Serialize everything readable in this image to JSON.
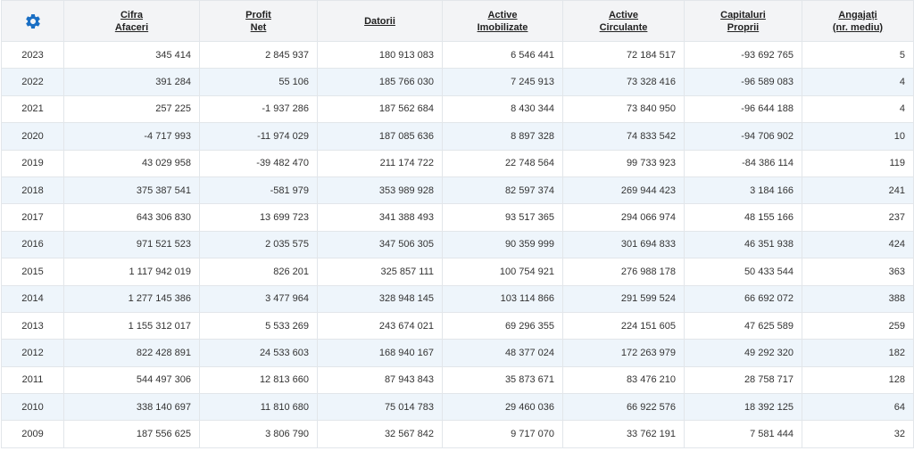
{
  "header": {
    "settings_icon": "gear-icon",
    "accent_color": "#1a6fc4",
    "columns": [
      {
        "line1": "Cifra",
        "line2": "Afaceri"
      },
      {
        "line1": "Profit",
        "line2": "Net"
      },
      {
        "line1": "Datorii",
        "line2": ""
      },
      {
        "line1": "Active",
        "line2": "Imobilizate"
      },
      {
        "line1": "Active",
        "line2": "Circulante"
      },
      {
        "line1": "Capitaluri",
        "line2": "Proprii"
      },
      {
        "line1": "Angajați",
        "line2": "(nr. mediu)"
      }
    ]
  },
  "rows": [
    [
      "2023",
      "345 414",
      "2 845 937",
      "180 913 083",
      "6 546 441",
      "72 184 517",
      "-93 692 765",
      "5"
    ],
    [
      "2022",
      "391 284",
      "55 106",
      "185 766 030",
      "7 245 913",
      "73 328 416",
      "-96 589 083",
      "4"
    ],
    [
      "2021",
      "257 225",
      "-1 937 286",
      "187 562 684",
      "8 430 344",
      "73 840 950",
      "-96 644 188",
      "4"
    ],
    [
      "2020",
      "-4 717 993",
      "-11 974 029",
      "187 085 636",
      "8 897 328",
      "74 833 542",
      "-94 706 902",
      "10"
    ],
    [
      "2019",
      "43 029 958",
      "-39 482 470",
      "211 174 722",
      "22 748 564",
      "99 733 923",
      "-84 386 114",
      "119"
    ],
    [
      "2018",
      "375 387 541",
      "-581 979",
      "353 989 928",
      "82 597 374",
      "269 944 423",
      "3 184 166",
      "241"
    ],
    [
      "2017",
      "643 306 830",
      "13 699 723",
      "341 388 493",
      "93 517 365",
      "294 066 974",
      "48 155 166",
      "237"
    ],
    [
      "2016",
      "971 521 523",
      "2 035 575",
      "347 506 305",
      "90 359 999",
      "301 694 833",
      "46 351 938",
      "424"
    ],
    [
      "2015",
      "1 117 942 019",
      "826 201",
      "325 857 111",
      "100 754 921",
      "276 988 178",
      "50 433 544",
      "363"
    ],
    [
      "2014",
      "1 277 145 386",
      "3 477 964",
      "328 948 145",
      "103 114 866",
      "291 599 524",
      "66 692 072",
      "388"
    ],
    [
      "2013",
      "1 155 312 017",
      "5 533 269",
      "243 674 021",
      "69 296 355",
      "224 151 605",
      "47 625 589",
      "259"
    ],
    [
      "2012",
      "822 428 891",
      "24 533 603",
      "168 940 167",
      "48 377 024",
      "172 263 979",
      "49 292 320",
      "182"
    ],
    [
      "2011",
      "544 497 306",
      "12 813 660",
      "87 943 843",
      "35 873 671",
      "83 476 210",
      "28 758 717",
      "128"
    ],
    [
      "2010",
      "338 140 697",
      "11 810 680",
      "75 014 783",
      "29 460 036",
      "66 922 576",
      "18 392 125",
      "64"
    ],
    [
      "2009",
      "187 556 625",
      "3 806 790",
      "32 567 842",
      "9 717 070",
      "33 762 191",
      "7 581 444",
      "32"
    ]
  ]
}
